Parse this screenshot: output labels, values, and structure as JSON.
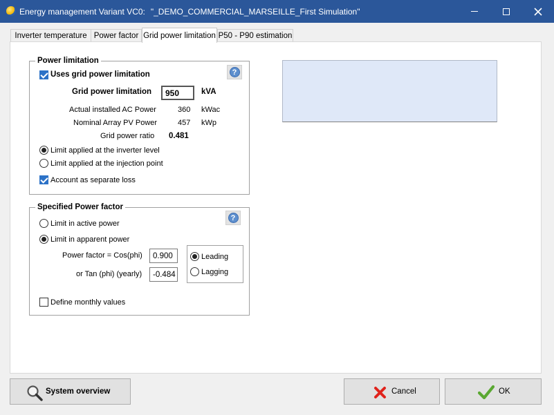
{
  "window": {
    "title_prefix": "Energy management Variant VC0:",
    "title_project": "\"_DEMO_COMMERCIAL_MARSEILLE_First Simulation\""
  },
  "tabs": [
    {
      "label": "Inverter temperature"
    },
    {
      "label": "Power factor"
    },
    {
      "label": "Grid power limitation",
      "active": true
    },
    {
      "label": "P50 - P90 estimation"
    }
  ],
  "power_limitation": {
    "legend": "Power limitation",
    "uses_label": "Uses grid power limitation",
    "uses_checked": true,
    "grid_label": "Grid power limitation",
    "grid_value": "950",
    "grid_unit": "kVA",
    "ac_label": "Actual installed AC Power",
    "ac_value": "360",
    "ac_unit": "kWac",
    "pv_label": "Nominal Array PV Power",
    "pv_value": "457",
    "pv_unit": "kWp",
    "ratio_label": "Grid power ratio",
    "ratio_value": "0.481",
    "inverter_level_label": "Limit applied at the inverter level",
    "injection_point_label": "Limit applied at the injection point",
    "selected_point": "inverter",
    "separate_loss_label": "Account as separate loss",
    "separate_loss_checked": true
  },
  "power_factor": {
    "legend": "Specified Power factor",
    "active_label": "Limit in active power",
    "apparent_label": "Limit in apparent power",
    "selected_limit": "apparent",
    "cos_label": "Power factor = Cos(phi)",
    "cos_value": "0.900",
    "tan_label": "or Tan (phi) (yearly)",
    "tan_value": "-0.484",
    "leading_label": "Leading",
    "lagging_label": "Lagging",
    "selected_phase": "leading",
    "monthly_label": "Define monthly values",
    "monthly_checked": false
  },
  "buttons": {
    "overview_label": "System overview",
    "cancel_label": "Cancel",
    "ok_label": "OK"
  },
  "icons": {
    "app": "app-sun-icon",
    "help": "help-icon",
    "search": "magnifier-icon",
    "cancel": "red-x-icon",
    "ok": "green-check-icon"
  },
  "colors": {
    "titlebar": "#2b579a",
    "accent_check": "#2c72c7",
    "cancel_red": "#e0231c",
    "ok_green": "#5aa832",
    "info_box": "#dfe8f8"
  }
}
